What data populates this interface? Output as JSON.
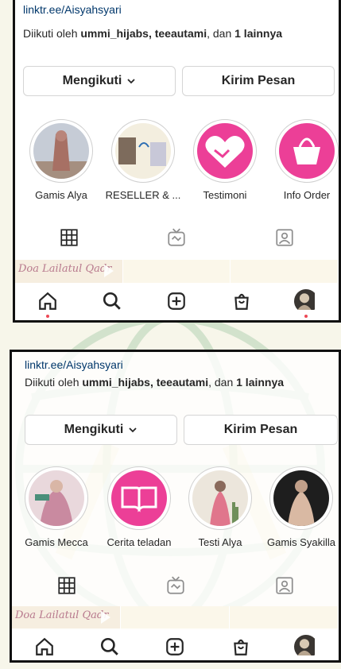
{
  "screenshots": [
    {
      "link": "linktr.ee/Aisyahsyari",
      "followed_prefix": "Diikuti oleh ",
      "followed_names": "ummi_hijabs, teeautami",
      "followed_mid": ", dan ",
      "followed_more": "1 lainnya",
      "follow_button": "Mengikuti",
      "message_button": "Kirim Pesan",
      "highlights": [
        {
          "label": "Gamis Alya"
        },
        {
          "label": "RESELLER & ..."
        },
        {
          "label": "Testimoni"
        },
        {
          "label": "Info Order"
        }
      ],
      "post_title": "Doa Lailatul Qadr"
    },
    {
      "link": "linktr.ee/Aisyahsyari",
      "followed_prefix": "Diikuti oleh ",
      "followed_names": "ummi_hijabs, teeautami",
      "followed_mid": ", dan ",
      "followed_more": "1 lainnya",
      "follow_button": "Mengikuti",
      "message_button": "Kirim Pesan",
      "highlights": [
        {
          "label": "Gamis Mecca"
        },
        {
          "label": "Cerita teladan"
        },
        {
          "label": "Testi Alya"
        },
        {
          "label": "Gamis Syakilla"
        }
      ],
      "post_title": "Doa Lailatul Qadr"
    }
  ],
  "icons": {
    "grid": "grid-icon",
    "igtv": "igtv-icon",
    "tagged": "tagged-icon",
    "home": "home-icon",
    "search": "search-icon",
    "add": "add-post-icon",
    "shop": "shop-icon"
  },
  "colors": {
    "link": "#00376b",
    "highlight_pink": "#ec3f97",
    "notification_dot": "#ed4956",
    "watermark_green": "#2f8b4a",
    "watermark_gold": "#e6c24a"
  }
}
